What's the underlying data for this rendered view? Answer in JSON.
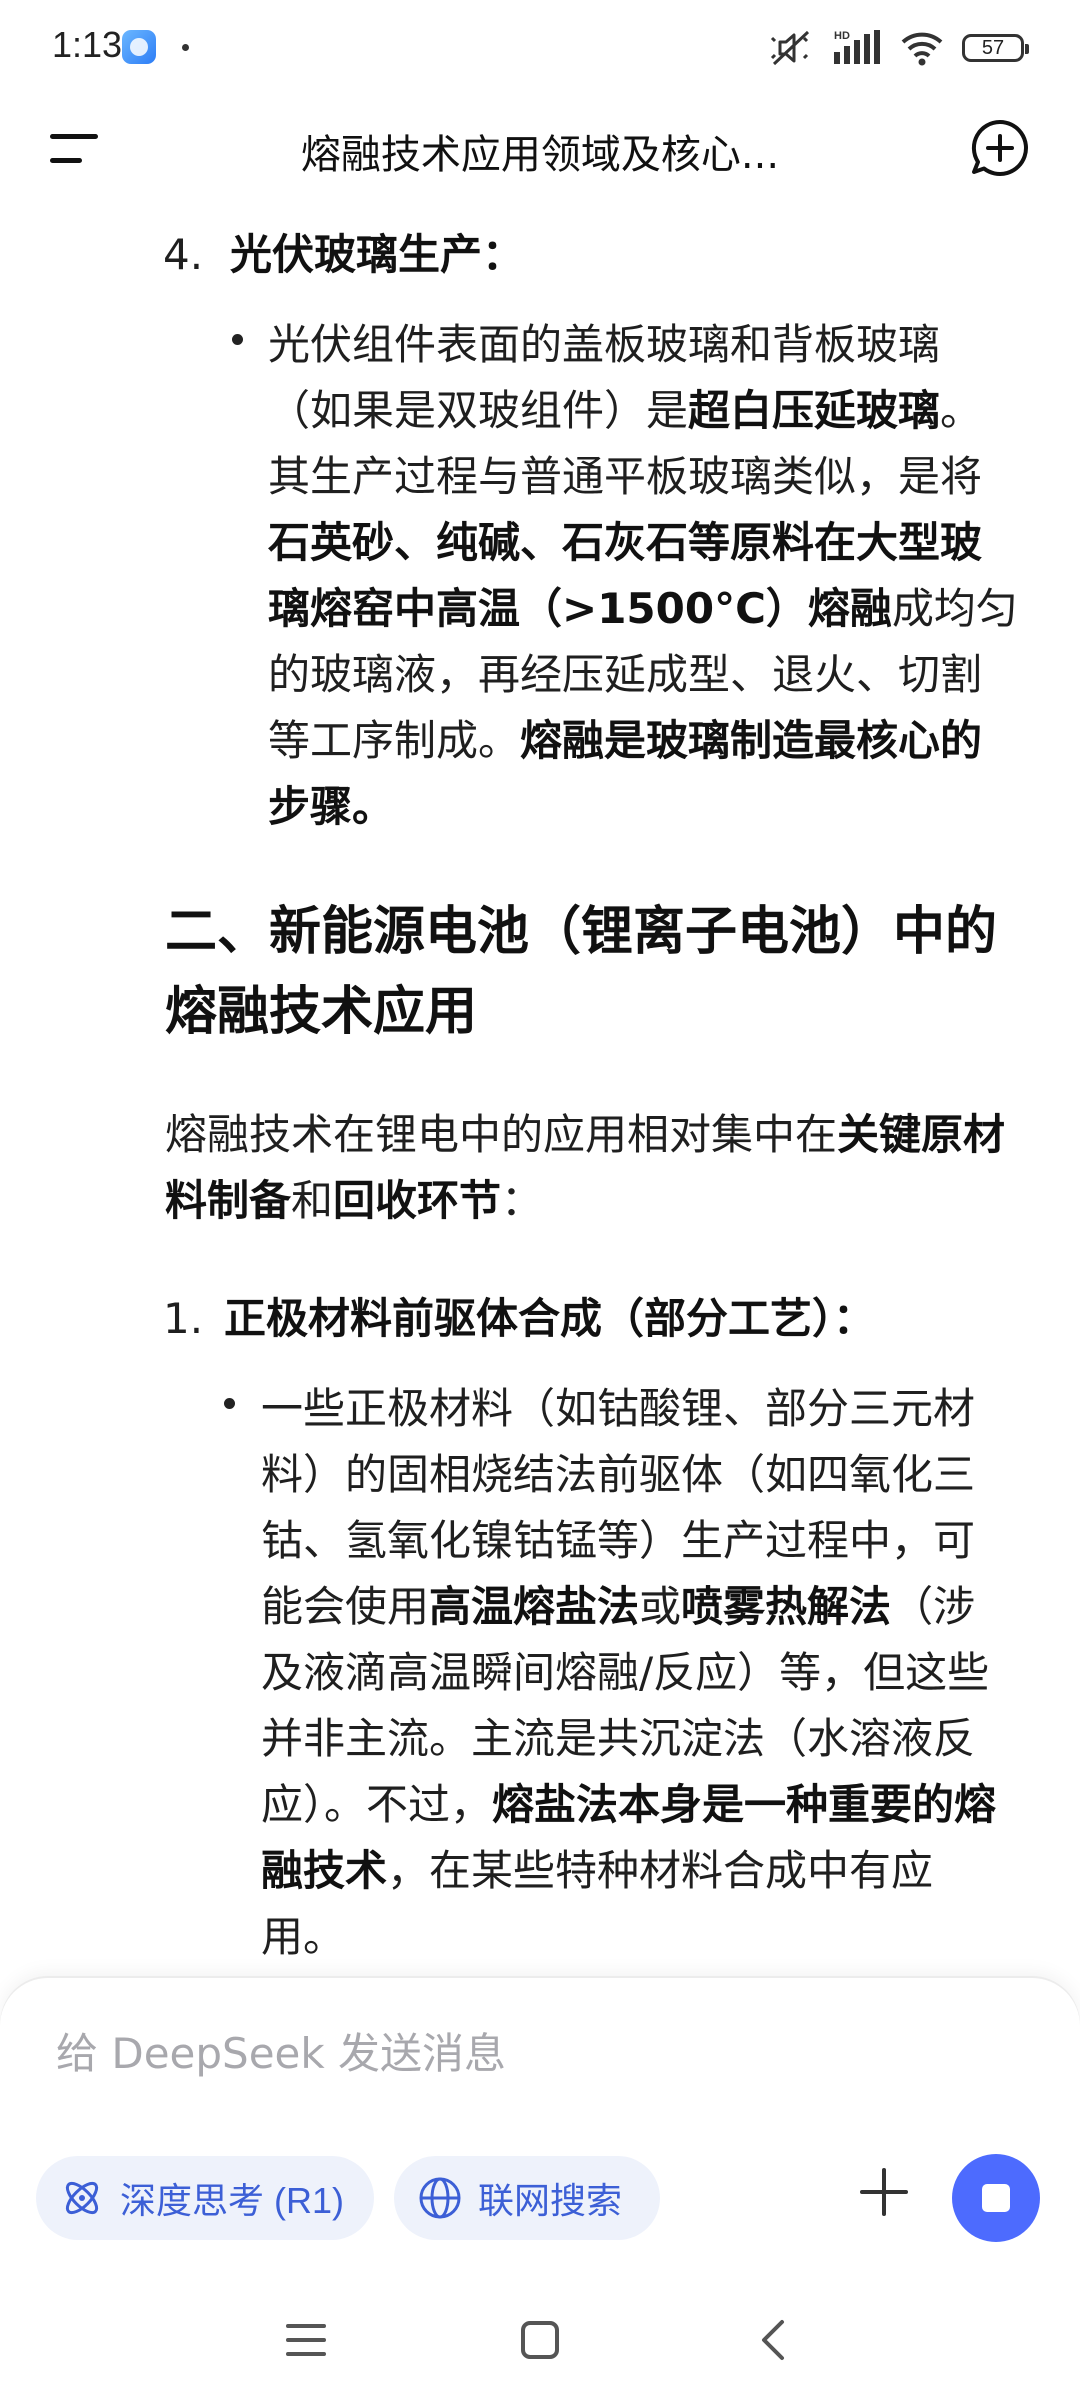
{
  "status_bar": {
    "time": "1:13",
    "battery": "57",
    "network_badge": "HD"
  },
  "header": {
    "title": "熔融技术应用领域及核心..."
  },
  "content": {
    "item4": {
      "number": "4.",
      "heading": "光伏玻璃生产：",
      "bullet": {
        "t1": "光伏组件表面的盖板玻璃和背板玻璃（如果是双玻组件）是",
        "b1": "超白压延玻璃",
        "t2": "。其生产过程与普通平板玻璃类似，是将",
        "b2": "石英砂、纯碱、石灰石等原料在大型玻璃熔窑中高温（>1500°C）熔融",
        "t3": "成均匀的玻璃液，再经压延成型、退火、切割等工序制成。",
        "b3": "熔融是玻璃制造最核心的步骤。"
      }
    },
    "section2_heading": "二、新能源电池（锂离子电池）中的熔融技术应用",
    "intro": {
      "t1": "熔融技术在锂电中的应用相对集中在",
      "b1": "关键原材料制备",
      "t2": "和",
      "b2": "回收环节",
      "t3": "："
    },
    "item1": {
      "number": "1.",
      "heading": "正极材料前驱体合成（部分工艺）：",
      "bullet": {
        "t1": "一些正极材料（如钴酸锂、部分三元材料）的固相烧结法前驱体（如四氧化三钴、氢氧化镍钴锰等）生产过程中，可能会使用",
        "b1": "高温熔盐法",
        "t2": "或",
        "b2": "喷雾热解法",
        "t3": "（涉及液滴高温瞬间熔融/反应）等，但这些并非主流。主流是共沉淀法（水溶液反应）。不过，",
        "b3": "熔盐法本身是一种重要的熔融技术",
        "t4": "，在某些特种材料合成中有应用。"
      }
    }
  },
  "composer": {
    "placeholder": "给 DeepSeek 发送消息",
    "deep_think_label": "深度思考 (R1)",
    "web_search_label": "联网搜索"
  },
  "colors": {
    "accent": "#4d6bfe",
    "pill_bg": "#eef2fb",
    "pill_text": "#3c5fd6"
  },
  "icons": {
    "menu": "menu-icon",
    "new_chat": "new-chat-icon",
    "deep_think": "atom-icon",
    "web_search": "globe-icon",
    "attach": "plus-icon",
    "stop": "stop-icon"
  }
}
